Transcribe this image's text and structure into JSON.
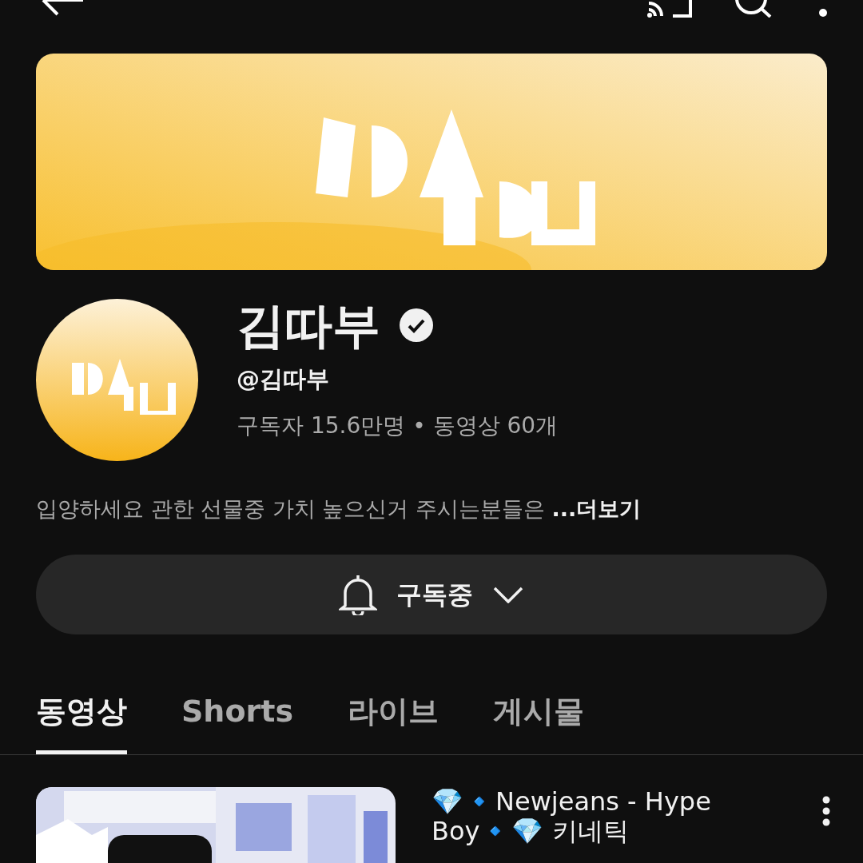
{
  "channel": {
    "name": "김따부",
    "verified": true,
    "handle": "@김따부",
    "stats": "구독자 15.6만명 • 동영상 60개",
    "description": "입양하세요 관한 선물중 가치 높으신거 주시는분들은 **...더보기**"
  },
  "subscribe_button": {
    "label": "구독중"
  },
  "tabs": [
    {
      "label": "동영상",
      "selected": true
    },
    {
      "label": "Shorts",
      "selected": false
    },
    {
      "label": "라이브",
      "selected": false
    },
    {
      "label": "게시물",
      "selected": false
    }
  ],
  "videos": [
    {
      "title": "💎🔹Newjeans - Hype Boy🔹💎 키네틱"
    }
  ]
}
